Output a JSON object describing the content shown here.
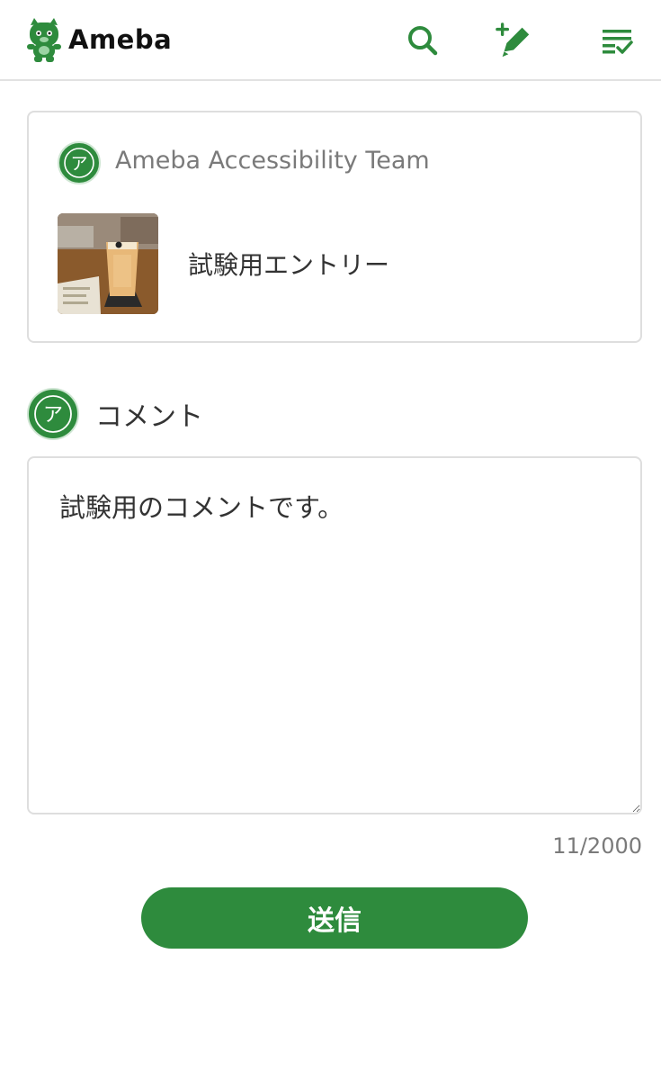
{
  "header": {
    "logo_text": "Ameba",
    "brand_color": "#2e8b3d",
    "icons": [
      "search-icon",
      "write-post-icon",
      "checklist-icon"
    ]
  },
  "entry": {
    "blog_name": "Ameba Accessibility Team",
    "avatar_letter": "ア",
    "title": "試験用エントリー"
  },
  "comment": {
    "label": "コメント",
    "avatar_letter": "ア",
    "text": "試験用のコメントです。",
    "counter": "11/2000"
  },
  "submit": {
    "label": "送信"
  }
}
